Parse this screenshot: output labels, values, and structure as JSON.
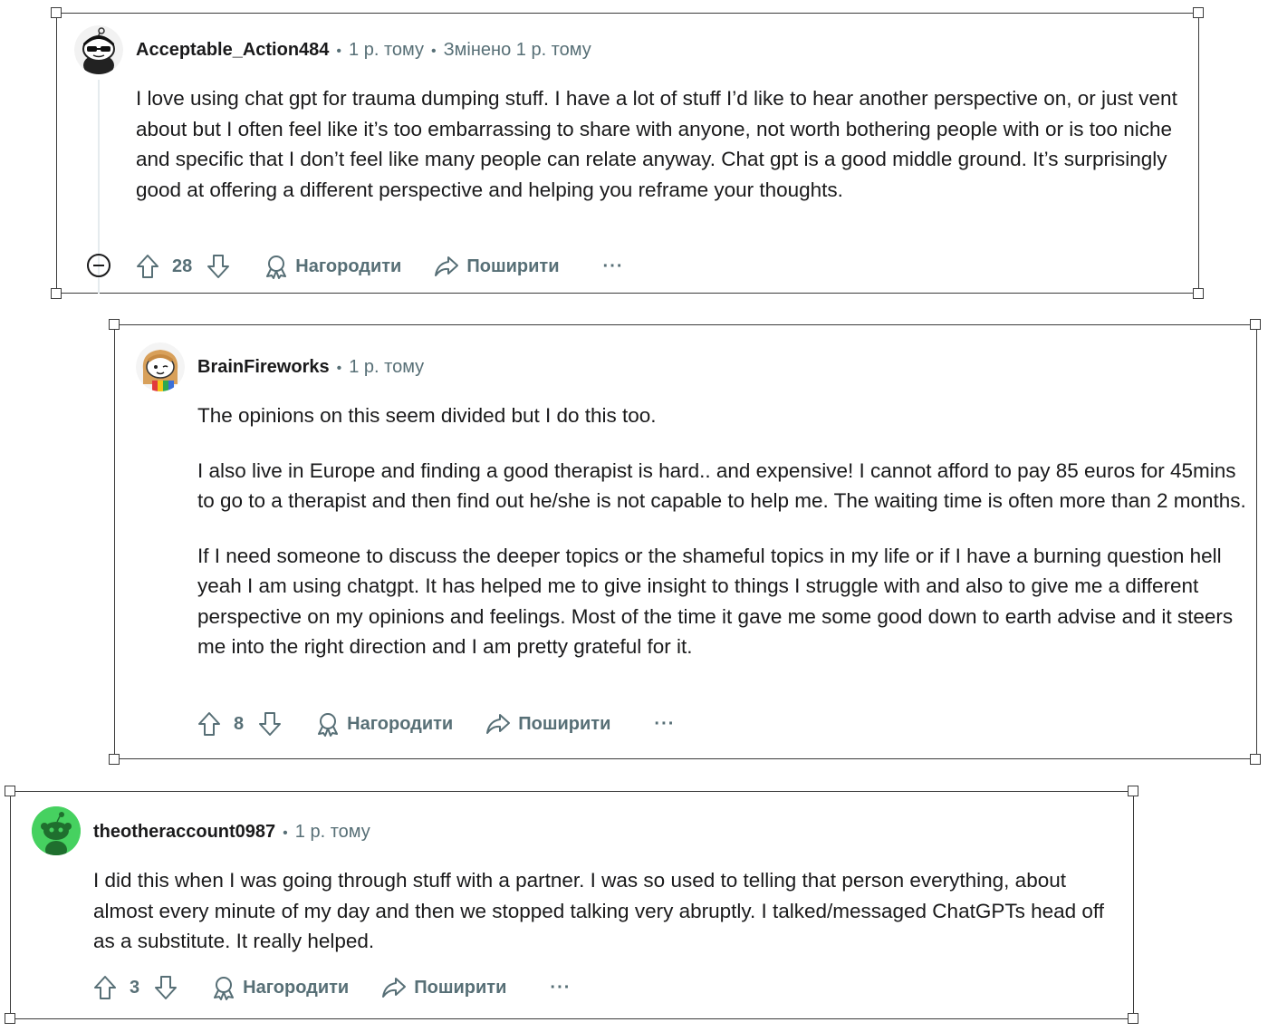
{
  "comments": [
    {
      "username": "Acceptable_Action484",
      "time": "1 р. тому",
      "edited": "Змінено 1 р. тому",
      "paragraphs": [
        "I love using chat gpt for trauma dumping stuff. I have a lot of stuff I’d like to hear another perspective on, or just vent about but I often feel like it’s too embarrassing to share with anyone, not worth bothering people with or is too niche and specific that I don’t feel like many people can relate anyway. Chat gpt is a good middle ground. It’s surprisingly good at offering a different perspective and helping you reframe your thoughts."
      ],
      "score": "28",
      "award_label": "Нагородити",
      "share_label": "Поширити",
      "more_label": "···"
    },
    {
      "username": "BrainFireworks",
      "time": "1 р. тому",
      "paragraphs": [
        "The opinions on this seem divided but I do this too.",
        "I also live in Europe and finding a good therapist is hard.. and expensive! I cannot afford to pay 85 euros for 45mins to go to a therapist and then find out he/she is not capable to help me. The waiting time is often more than 2 months.",
        "If I need someone to discuss the deeper topics or the shameful topics in my life or if I have a burning question hell yeah I am using chatgpt. It has helped me to give insight to things I struggle with and also to give me a different perspective on my opinions and feelings. Most of the time it gave me some good down to earth advise and it steers me into the right direction and I am pretty grateful for it."
      ],
      "score": "8",
      "award_label": "Нагородити",
      "share_label": "Поширити",
      "more_label": "···"
    },
    {
      "username": "theotheraccount0987",
      "time": "1 р. тому",
      "paragraphs": [
        "I did this when I was going through stuff with a partner. I was so used to telling that person everything, about almost every minute of my day and then we stopped talking very abruptly. I talked/messaged ChatGPTs head off as a substitute. It really helped."
      ],
      "score": "3",
      "award_label": "Нагородити",
      "share_label": "Поширити",
      "more_label": "···"
    }
  ],
  "icons": {
    "upvote": "arrow-up-icon",
    "downvote": "arrow-down-icon",
    "award": "award-icon",
    "share": "share-icon",
    "collapse": "collapse-thread-icon"
  },
  "colors": {
    "text": "#1a1a1b",
    "meta": "#576f76",
    "frame": "#3b3b3b",
    "avatar3_bg": "#46d160"
  }
}
